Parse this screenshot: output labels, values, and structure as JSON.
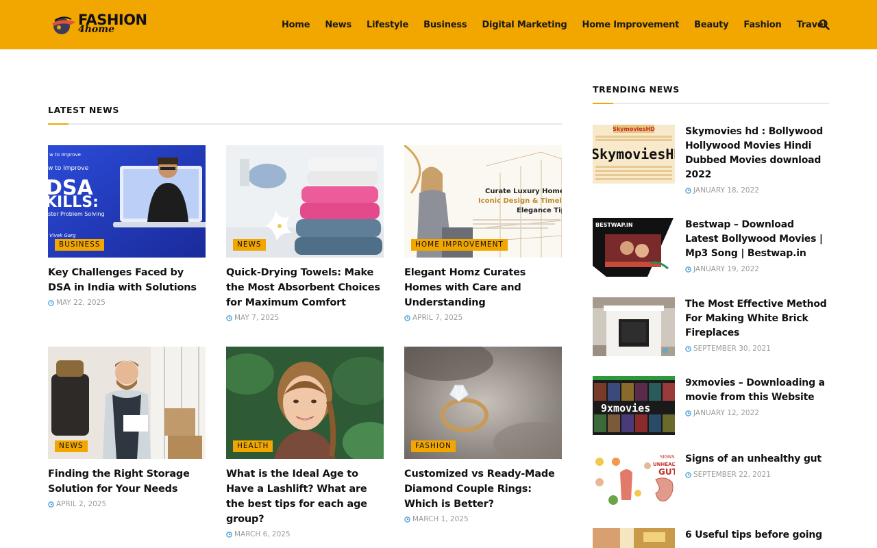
{
  "brand": {
    "name": "FASHION",
    "sub": "4home"
  },
  "nav": [
    "Home",
    "News",
    "Lifestyle",
    "Business",
    "Digital Marketing",
    "Home Improvement",
    "Beauty",
    "Fashion",
    "Travel"
  ],
  "colors": {
    "accent": "#f2a600",
    "text": "#111111",
    "meta": "#9a9a9a"
  },
  "latest": {
    "heading": "LATEST NEWS",
    "cards": [
      {
        "category": "BUSINESS",
        "title": "Key Challenges Faced by DSA in India with Solutions",
        "date": "MAY 22, 2025",
        "thumb_text": [
          "w to Improve",
          "DSA",
          "KILLS:",
          "ster Problem Solving",
          "Vivek Garg"
        ]
      },
      {
        "category": "NEWS",
        "title": "Quick-Drying Towels: Make the Most Absorbent Choices for Maximum Comfort",
        "date": "MAY 7, 2025"
      },
      {
        "category": "HOME IMPROVEMENT",
        "title": "Elegant Homz Curates Homes with Care and Understanding",
        "date": "APRIL 7, 2025",
        "thumb_text": [
          "Curate Luxury Homes",
          "Iconic Design & Timeless",
          "Elegance Tip"
        ]
      },
      {
        "category": "NEWS",
        "title": "Finding the Right Storage Solution for Your Needs",
        "date": "APRIL 2, 2025"
      },
      {
        "category": "HEALTH",
        "title": "What is the Ideal Age to Have a Lashlift? What are the best tips for each age group?",
        "date": "MARCH 6, 2025"
      },
      {
        "category": "FASHION",
        "title": "Customized vs Ready-Made Diamond Couple Rings: Which is Better?",
        "date": "MARCH 1, 2025"
      }
    ]
  },
  "trending": {
    "heading": "TRENDING NEWS",
    "items": [
      {
        "title": "Skymovies hd : Bollywood Hollywood Movies Hindi Dubbed Movies download 2022",
        "date": "JANUARY 18, 2022",
        "thumb_text": [
          "SkymoviesHD",
          "SkymoviesHD"
        ]
      },
      {
        "title": "Bestwap – Download Latest Bollywood Movies | Mp3 Song | Bestwap.in",
        "date": "JANUARY 19, 2022",
        "thumb_text": [
          "BESTWAP.IN"
        ]
      },
      {
        "title": "The Most Effective Method For Making White Brick Fireplaces",
        "date": "SEPTEMBER 30, 2021"
      },
      {
        "title": "9xmovies – Downloading a movie from this Website",
        "date": "JANUARY 12, 2022",
        "thumb_text": [
          "9xmovies"
        ]
      },
      {
        "title": "Signs of an unhealthy gut",
        "date": "SEPTEMBER 22, 2021",
        "thumb_text": [
          "SIGNS",
          "UNHEALTHY",
          "GUT"
        ]
      },
      {
        "title": "6 Useful tips before going",
        "date": ""
      }
    ]
  }
}
